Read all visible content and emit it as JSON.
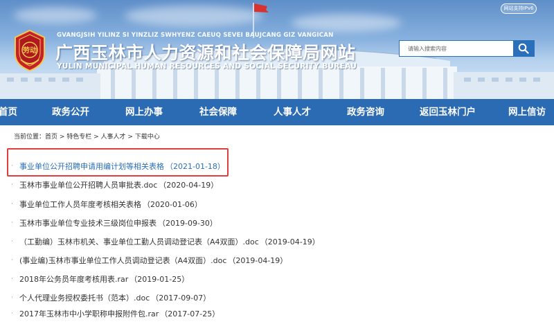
{
  "header": {
    "ipv6_badge": "网站支持IPv6",
    "pinyin": "GVANGJSIH YILINZ SI YINZLIZ SWHYENZ CAEUQ SEVEI BAUJCANG GIZ VANGICAN",
    "title": "广西玉林市人力资源和社会保障局网站",
    "title_en": "YULIN MUNICIPAL HUMAN RESOURCES AND SOCIAL SECURITY BUREAU",
    "emblem_text": "劳动"
  },
  "search": {
    "placeholder": "请输入搜索内容"
  },
  "nav": {
    "items": [
      {
        "label": "首页"
      },
      {
        "label": "政务公开"
      },
      {
        "label": "网上办事"
      },
      {
        "label": "社会保障"
      },
      {
        "label": "人事人才"
      },
      {
        "label": "政务咨询"
      },
      {
        "label": "返回玉林门户"
      },
      {
        "label": "网上信访"
      }
    ]
  },
  "breadcrumb": {
    "text": "当前位置：首页 > 特色专栏 > 人事人才 > 下载中心"
  },
  "downloads": [
    {
      "title": "事业单位公开招聘申请用编计划等相关表格",
      "date": "（2021-01-18）"
    },
    {
      "title": "玉林市事业单位公开招聘人员审批表.doc",
      "date": "（2020-04-19）"
    },
    {
      "title": "事业单位工作人员年度考核相关表格",
      "date": "（2020-01-06）"
    },
    {
      "title": "玉林市事业单位专业技术三级岗位申报表",
      "date": "（2019-09-30）"
    },
    {
      "title": "（工勤编）玉林市机关、事业单位工勤人员调动登记表（A4双面）.doc",
      "date": "（2019-04-19）"
    },
    {
      "title": "(事业编)玉林市事业单位工作人员调动登记表（A4双面）.doc",
      "date": "（2019-04-19）"
    },
    {
      "title": "2018年公务员年度考核用表.rar",
      "date": "（2019-01-25）"
    },
    {
      "title": "个人代理业务授权委托书（范本）.doc",
      "date": "（2017-09-07）"
    },
    {
      "title": "2017年玉林市中小学职称申报附件包.rar",
      "date": "（2017-07-25）"
    }
  ],
  "colors": {
    "nav_bg": "#2b6bb3",
    "highlight_border": "#e23c3c",
    "link_blue": "#2a6fb9"
  }
}
